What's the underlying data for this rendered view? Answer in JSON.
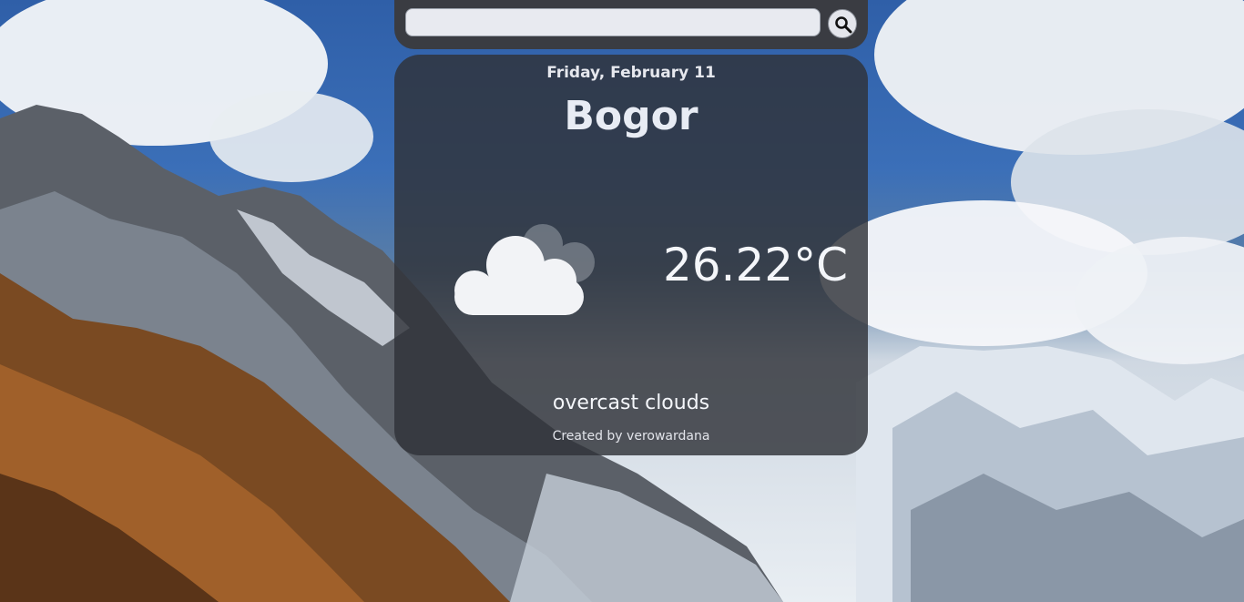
{
  "search": {
    "value": "",
    "placeholder": "",
    "button_icon": "search-icon"
  },
  "weather": {
    "date": "Friday, February 11",
    "city": "Bogor",
    "temperature": "26.22°C",
    "description": "overcast clouds",
    "icon": "cloud-icon"
  },
  "footer": {
    "credit": "Created by verowardana"
  },
  "colors": {
    "card": "#303238",
    "search_bar": "#3a3c42",
    "text": "#f0f2f6"
  }
}
